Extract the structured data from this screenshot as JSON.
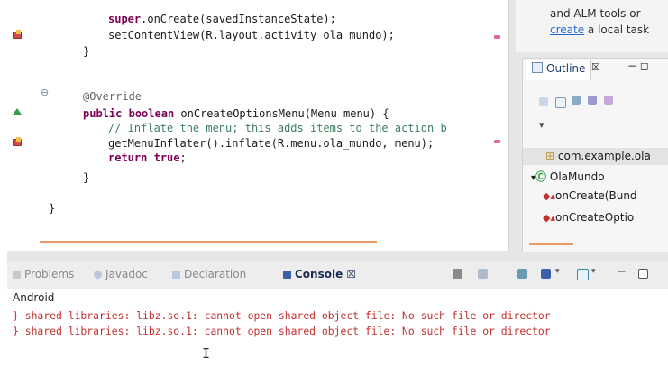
{
  "editor": {
    "lines": {
      "l1": {
        "kw": "super",
        "rest": ".onCreate(savedInstanceState);"
      },
      "l2": "setContentView(R.layout.activity_ola_mundo);",
      "l3": "}",
      "l4": "@Override",
      "l5": {
        "kw1": "public",
        "kw2": "boolean",
        "rest": " onCreateOptionsMenu(Menu menu) {"
      },
      "l6": "// Inflate the menu; this adds items to the action b",
      "l7": "getMenuInflater().inflate(R.menu.ola_mundo, menu);",
      "l8": {
        "kw": "return",
        "kw2": "true",
        "rest": ";"
      },
      "l9": "}",
      "l10": "}"
    }
  },
  "task_hint": {
    "line1": "and ALM tools or",
    "link": "create",
    "line2_rest": " a local task"
  },
  "outline": {
    "tab_label": "Outline",
    "close_glyph": "☒",
    "window_controls": "−  ◻",
    "tree": [
      {
        "label": "com.example.ola"
      },
      {
        "label": "OlaMundo"
      },
      {
        "label": "onCreate(Bund"
      },
      {
        "label": "onCreateOptio"
      }
    ]
  },
  "console": {
    "tabs": [
      {
        "label": "Problems"
      },
      {
        "label": "Javadoc"
      },
      {
        "label": "Declaration"
      },
      {
        "label": "Console"
      }
    ],
    "active_tab_close": "☒",
    "label": "Android",
    "lines": [
      "} shared libraries: libz.so.1: cannot open shared object file: No such file or director",
      "} shared libraries: libz.so.1: cannot open shared object file: No such file or director"
    ],
    "cursor_glyph": "I"
  },
  "colors": {
    "keyword": "#7f0055",
    "comment": "#3f7f5f",
    "annotation": "#646464",
    "error_text": "#c0302c",
    "link": "#2a6bd1"
  }
}
